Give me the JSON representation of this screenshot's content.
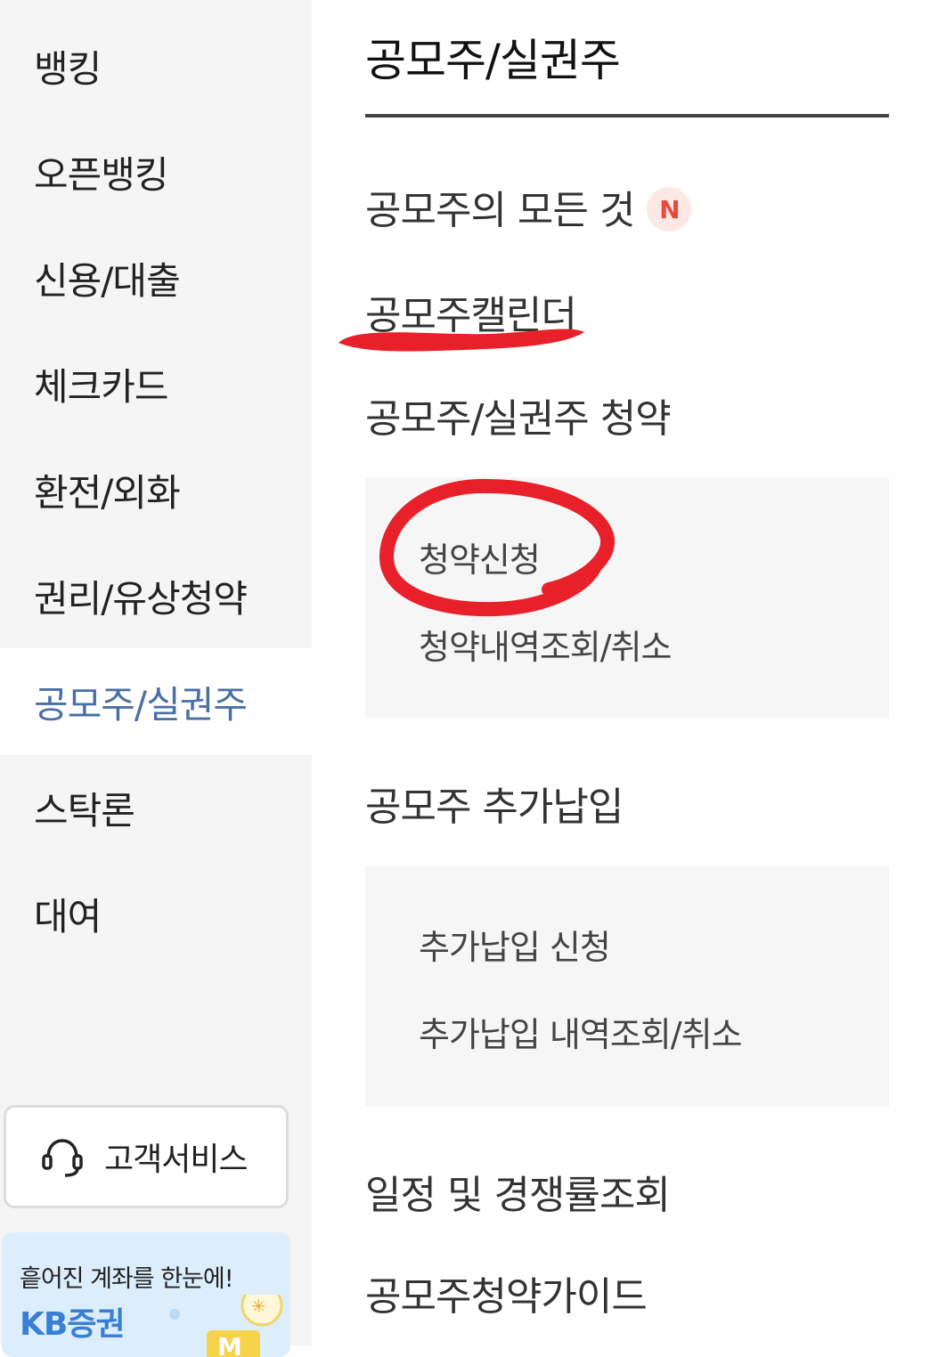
{
  "sidebar": {
    "items": [
      {
        "label": "뱅킹"
      },
      {
        "label": "오픈뱅킹"
      },
      {
        "label": "신용/대출"
      },
      {
        "label": "체크카드"
      },
      {
        "label": "환전/외화"
      },
      {
        "label": "권리/유상청약"
      },
      {
        "label": "공모주/실권주"
      },
      {
        "label": "스탁론"
      },
      {
        "label": "대여"
      }
    ],
    "active_index": 6,
    "customer_service": "고객서비스",
    "banner": {
      "text": "흩어진 계좌를 한눈에!",
      "brand": "KB증권"
    }
  },
  "main": {
    "title": "공모주/실권주",
    "menu": {
      "all_about": "공모주의 모든 것",
      "new_badge": "N",
      "calendar": "공모주캘린더",
      "subscription": "공모주/실권주 청약",
      "subscription_sub": [
        "청약신청",
        "청약내역조회/취소"
      ],
      "additional_payment": "공모주 추가납입",
      "additional_payment_sub": [
        "추가납입 신청",
        "추가납입 내역조회/취소"
      ],
      "schedule": "일정 및 경쟁률조회",
      "guide": "공모주청약가이드"
    }
  },
  "colors": {
    "active_text": "#4a6fa5",
    "badge_bg": "#fde8e6",
    "badge_text": "#e84a3c",
    "annotation_red": "#e8202a"
  }
}
